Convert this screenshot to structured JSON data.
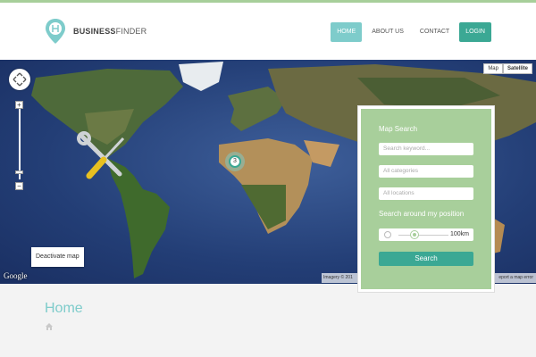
{
  "brand": {
    "name_bold": "BUSINESS",
    "name_rest": "FINDER",
    "accent": "#7ecccb",
    "primary": "#3ba894",
    "panel": "#a8cf9b"
  },
  "nav": {
    "items": [
      "HOME",
      "ABOUT US",
      "CONTACT"
    ],
    "login": "LOGIN",
    "active": "HOME"
  },
  "map": {
    "type_buttons": [
      "Map",
      "Satellite"
    ],
    "active_type": "Satellite",
    "cluster_count": "3",
    "deactivate_label": "Deactivate map",
    "google_logo": "Google",
    "imagery_text": "Imagery © 201",
    "report_text": "eport a map error",
    "zoom_in": "+",
    "zoom_out": "−"
  },
  "search": {
    "title": "Map Search",
    "keyword_placeholder": "Search keyword...",
    "categories_placeholder": "All categories",
    "locations_placeholder": "All locations",
    "radius_label": "Search around my position",
    "radius_value": "100km",
    "button": "Search"
  },
  "page": {
    "title": "Home"
  }
}
